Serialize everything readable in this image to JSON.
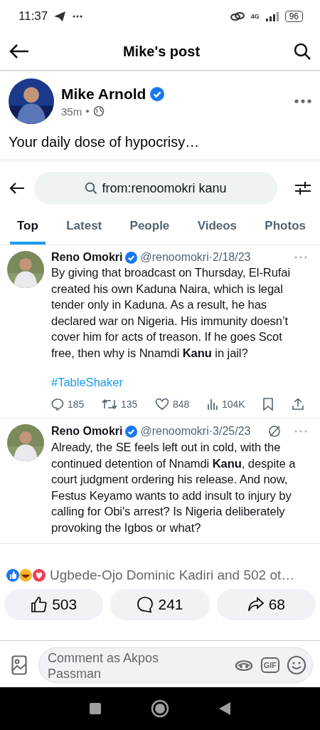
{
  "status_bar": {
    "time": "11:37",
    "network": "4G",
    "battery": "96"
  },
  "header": {
    "title": "Mike's post"
  },
  "post": {
    "author": "Mike Arnold",
    "verified": true,
    "time": "35m",
    "text": "Your daily dose of hypocrisy…"
  },
  "shared_screenshot": {
    "search": {
      "value": "from:renoomokri kanu"
    },
    "tabs": [
      {
        "label": "Top",
        "selected": true
      },
      {
        "label": "Latest",
        "selected": false
      },
      {
        "label": "People",
        "selected": false
      },
      {
        "label": "Videos",
        "selected": false
      },
      {
        "label": "Photos",
        "selected": false
      }
    ],
    "tweets": [
      {
        "name": "Reno Omokri",
        "verified": true,
        "meta": "@renoomokri·2/18/23",
        "text": "By giving that broadcast on Thursday, El-Rufai created his own Kaduna Naira, which is legal tender only in Kaduna. As a result, he has declared war on Nigeria. His immunity doesn’t cover him for acts of treason. If he goes Scot free, then why is Nnamdi **Kanu** in jail?",
        "hashtag": "#TableShaker",
        "stats": {
          "replies": "185",
          "reposts": "135",
          "likes": "848",
          "views": "104K"
        }
      },
      {
        "name": "Reno Omokri",
        "verified": true,
        "meta": "@renoomokri·3/25/23",
        "edited": true,
        "text": "Already, the SE feels left out in cold, with the continued detention of Nnamdi **Kanu**, despite a court judgment ordering his release. And now, Festus Keyamo wants to add insult to injury by calling for Obi's arrest? Is Nigeria deliberately provoking the Igbos or what?"
      }
    ]
  },
  "reactions": {
    "summary": "Ugbede-Ojo Dominic Kadiri and 502 ot…"
  },
  "actions": [
    {
      "kind": "like",
      "count": "503"
    },
    {
      "kind": "comment",
      "count": "241"
    },
    {
      "kind": "share",
      "count": "68"
    }
  ],
  "comment_bar": {
    "placeholder": "Comment as Akpos Passman",
    "gif_label": "GIF"
  }
}
